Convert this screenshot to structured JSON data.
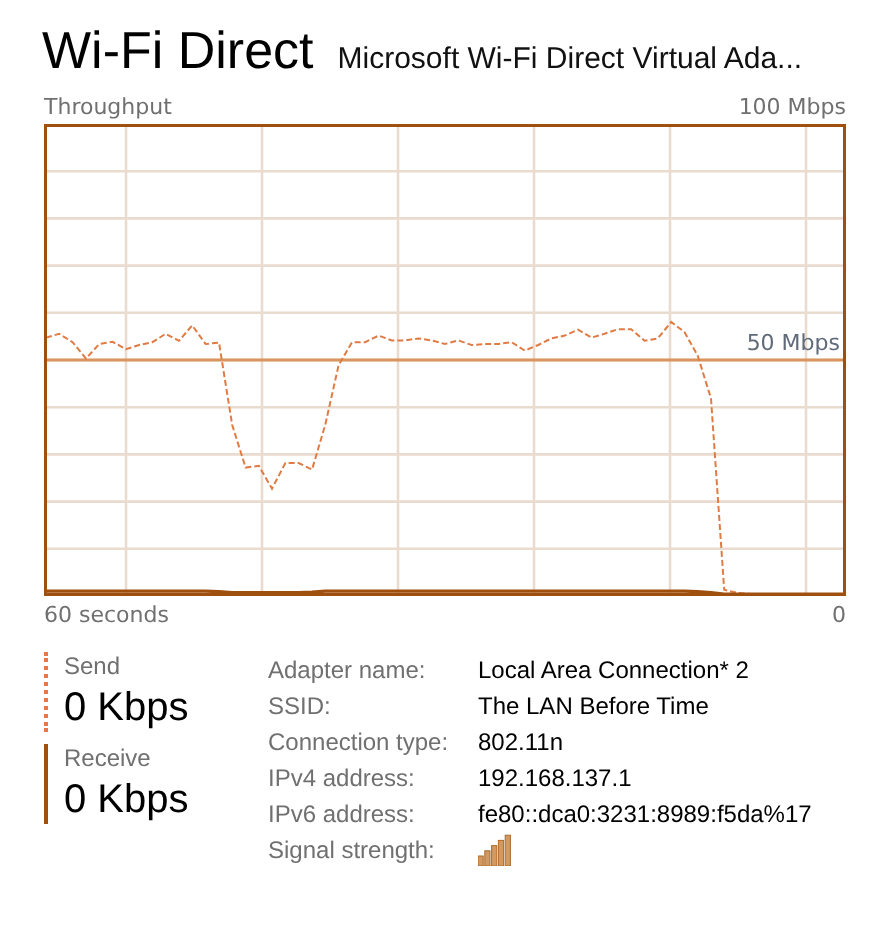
{
  "header": {
    "title": "Wi-Fi Direct",
    "adapter": "Microsoft Wi-Fi Direct Virtual Ada..."
  },
  "chart": {
    "title": "Throughput",
    "scale_max": "100 Mbps",
    "scale_mark": "50 Mbps",
    "time_span": "60 seconds",
    "time_end": "0"
  },
  "stats": [
    {
      "kind": "dashed",
      "label": "Send",
      "value": "0 Kbps"
    },
    {
      "kind": "solid",
      "label": "Receive",
      "value": "0 Kbps"
    }
  ],
  "details": [
    {
      "label": "Adapter name:",
      "value": "Local Area Connection* 2"
    },
    {
      "label": "SSID:",
      "value": "The LAN Before Time"
    },
    {
      "label": "Connection type:",
      "value": "802.11n"
    },
    {
      "label": "IPv4 address:",
      "value": "192.168.137.1"
    },
    {
      "label": "IPv6 address:",
      "value": "fe80::dca0:3231:8989:f5da%17"
    },
    {
      "label": "Signal strength:",
      "kind": "signal"
    }
  ]
}
